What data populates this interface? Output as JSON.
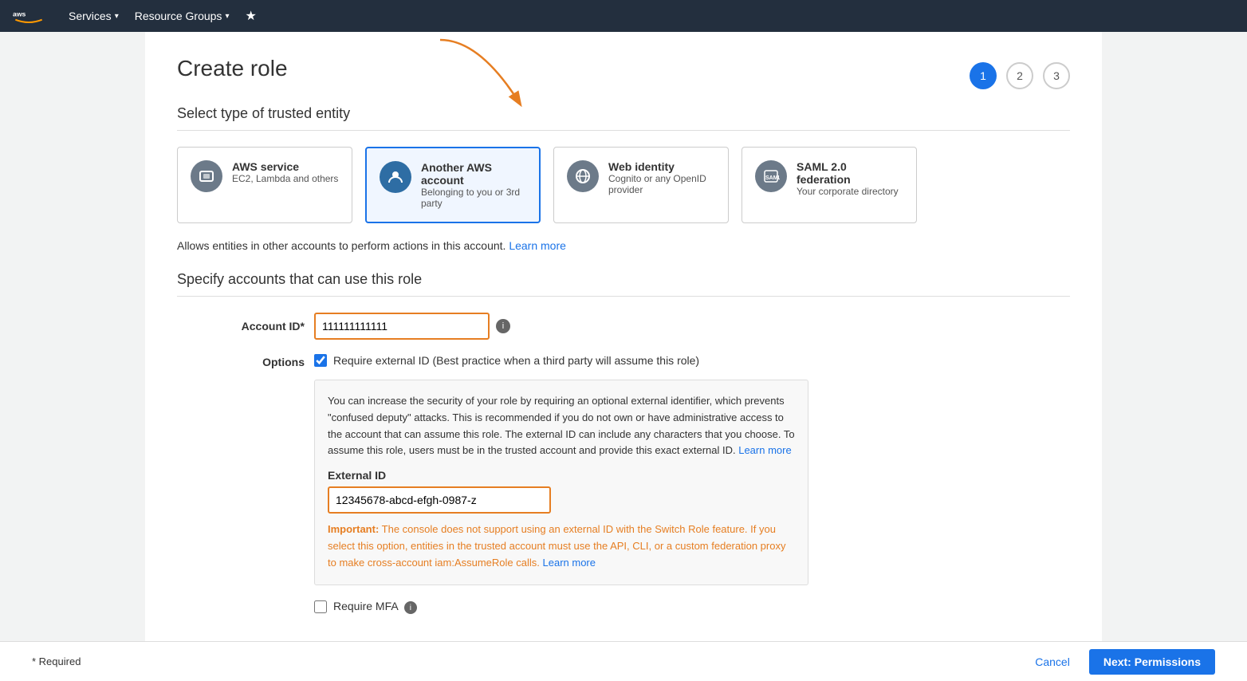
{
  "nav": {
    "services_label": "Services",
    "resource_groups_label": "Resource Groups"
  },
  "page": {
    "title": "Create role",
    "steps": [
      "1",
      "2",
      "3"
    ]
  },
  "trusted_entity": {
    "section_title": "Select type of trusted entity",
    "cards": [
      {
        "id": "aws-service",
        "title": "AWS service",
        "subtitle": "EC2, Lambda and others",
        "icon": "box",
        "selected": false
      },
      {
        "id": "another-aws-account",
        "title": "Another AWS account",
        "subtitle": "Belonging to you or 3rd party",
        "icon": "person",
        "selected": true
      },
      {
        "id": "web-identity",
        "title": "Web identity",
        "subtitle": "Cognito or any OpenID provider",
        "icon": "www",
        "selected": false
      },
      {
        "id": "saml",
        "title": "SAML 2.0 federation",
        "subtitle": "Your corporate directory",
        "icon": "saml",
        "selected": false
      }
    ],
    "description": "Allows entities in other accounts to perform actions in this account.",
    "learn_more_1": "Learn more"
  },
  "accounts_section": {
    "section_title": "Specify accounts that can use this role",
    "account_id_label": "Account ID*",
    "account_id_value": "111111111111",
    "options_label": "Options",
    "require_external_id_label": "Require external ID (Best practice when a third party will assume this role)",
    "require_external_id_checked": true,
    "info_box_text": "You can increase the security of your role by requiring an optional external identifier, which prevents \"confused deputy\" attacks. This is recommended if you do not own or have administrative access to the account that can assume this role. The external ID can include any characters that you choose. To assume this role, users must be in the trusted account and provide this exact external ID.",
    "learn_more_2": "Learn more",
    "external_id_label": "External ID",
    "external_id_value": "12345678-abcd-efgh-0987-z",
    "warning_text_bold": "Important:",
    "warning_text": " The console does not support using an external ID with the Switch Role feature. If you select this option, entities in the trusted account must use the API, CLI, or a custom federation proxy to make cross-account iam:AssumeRole calls.",
    "learn_more_3": "Learn more",
    "require_mfa_label": "Require MFA"
  },
  "footer": {
    "required_text": "* Required",
    "cancel_label": "Cancel",
    "next_label": "Next: Permissions"
  }
}
